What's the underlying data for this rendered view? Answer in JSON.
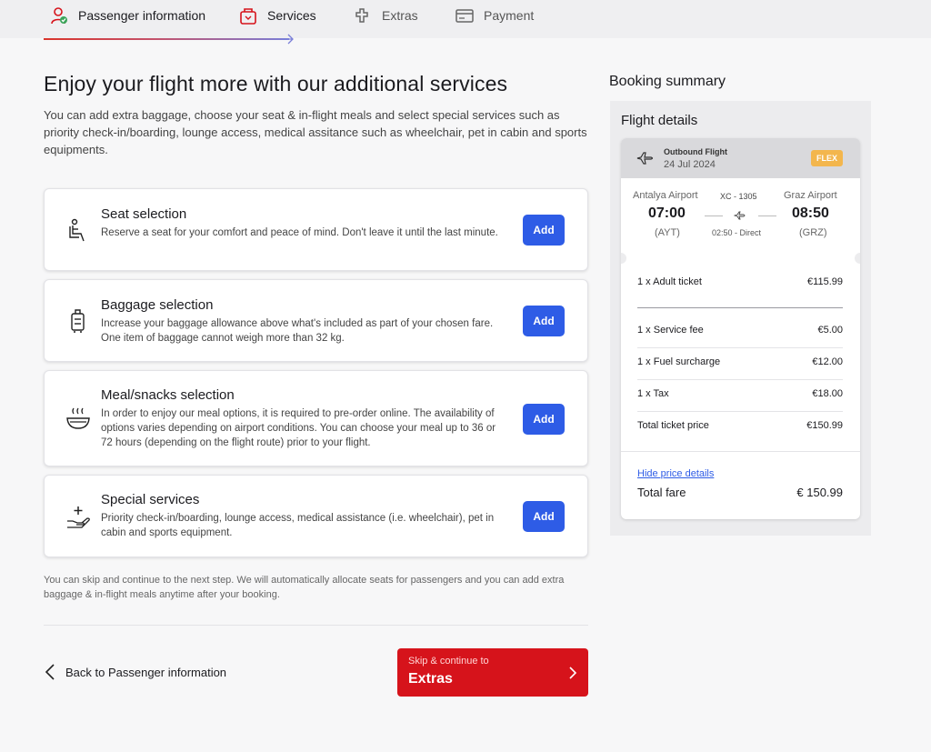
{
  "steps": [
    {
      "label": "Passenger information",
      "icon": "passenger-check-icon",
      "active": true
    },
    {
      "label": "Services",
      "icon": "services-bag-icon",
      "active": true
    },
    {
      "label": "Extras",
      "icon": "extras-puzzle-icon",
      "active": false
    },
    {
      "label": "Payment",
      "icon": "payment-card-icon",
      "active": false
    }
  ],
  "main": {
    "title": "Enjoy your flight more with our additional services",
    "intro": "You can add extra baggage, choose your seat & in-flight meals and select special services such as priority check-in/boarding, lounge access, medical assitance such as wheelchair, pet in cabin and sports equipments.",
    "services": [
      {
        "title": "Seat selection",
        "desc": "Reserve a seat for your comfort and peace of mind. Don't leave it until the last minute.",
        "button": "Add",
        "icon": "seat-icon"
      },
      {
        "title": "Baggage selection",
        "desc": "Increase your baggage allowance above what's included as part of your chosen fare. One item of baggage cannot weigh more than 32 kg.",
        "button": "Add",
        "icon": "luggage-icon"
      },
      {
        "title": "Meal/snacks selection",
        "desc": "In order to enjoy our meal options, it is required to pre-order online. The availability of options varies depending on airport conditions. You can choose your meal up to 36 or 72 hours (depending on the flight route) prior to your flight.",
        "button": "Add",
        "icon": "meal-bowl-icon"
      },
      {
        "title": "Special services",
        "desc": "Priority check-in/boarding, lounge access, medical assistance (i.e. wheelchair), pet in cabin and sports equipment.",
        "button": "Add",
        "icon": "special-care-icon"
      }
    ],
    "skip_note": "You can skip and continue to the next step. We will automatically allocate seats for passengers and you can add extra baggage & in-flight meals anytime after your booking.",
    "back_label": "Back to Passenger information",
    "cta_small": "Skip & continue to",
    "cta_big": "Extras"
  },
  "summary": {
    "title": "Booking summary",
    "flight_details_title": "Flight details",
    "outbound_label": "Outbound Flight",
    "date": "24 Jul 2024",
    "badge": "FLEX",
    "origin_airport": "Antalya Airport",
    "origin_time": "07:00",
    "origin_code": "(AYT)",
    "flight_no": "XC - 1305",
    "duration": "02:50 - Direct",
    "dest_airport": "Graz Airport",
    "dest_time": "08:50",
    "dest_code": "(GRZ)",
    "prices": [
      {
        "label": "1 x Adult ticket",
        "value": "€115.99"
      },
      {
        "label": "1 x Service fee",
        "value": "€5.00"
      },
      {
        "label": "1 x Fuel surcharge",
        "value": "€12.00"
      },
      {
        "label": "1 x Tax",
        "value": "€18.00"
      },
      {
        "label": "Total ticket price",
        "value": "€150.99"
      }
    ],
    "hide_link": "Hide price details",
    "total_label": "Total fare",
    "total_value": "€ 150.99"
  },
  "colors": {
    "primary": "#2e5ce6",
    "cta": "#d6131b",
    "badge": "#f3b64d"
  }
}
